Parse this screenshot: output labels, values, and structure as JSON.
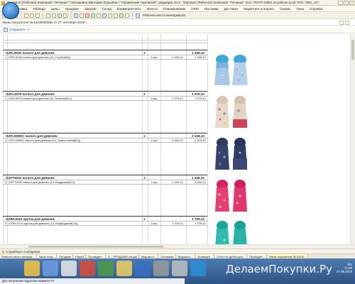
{
  "window": {
    "title": "Торговля (Рабочая) Компания \"Пеликан\" / Малашина Виктория Юрьевна / \"Управление торговлей\", редакция 10.3 - Торговля (Рабочая) Компания \"Пеликан\" Srvr=\"RSTD-DB01.int.pelican.local\";Ref=\"sl82_rst\";"
  },
  "menu": [
    "Файл",
    "Правка",
    "Таблица",
    "Цены",
    "Продажи",
    "Закупки",
    "Склад",
    "Взаиморасчеты",
    "Зачеты",
    "Планирование",
    "CRM",
    "Поставки",
    "Доставка",
    "Маркетинг и анализ",
    "Сервис",
    "Окна",
    "Справка"
  ],
  "toolbar": {
    "label": "Рабочее место менеджеров"
  },
  "document": {
    "title": "Заказ покупателя № 61/00009355 от 27 сентября 2019 г.",
    "save_label": "Сохранить"
  },
  "products": [
    {
      "title": "GZFL5030 пальто для девочек",
      "qty": "1",
      "sum": "1 439,10",
      "row": {
        "num": "1",
        "desc": "GZFL5030 пальто для девочек (14, Голубой(9))",
        "qty": "1 кор",
        "price": "1 439,10",
        "sum": "1 439,10"
      }
    },
    {
      "title": "GZFL5079 пальто для девочек",
      "qty": "1",
      "sum": "1 979,10",
      "row": {
        "num": "2",
        "desc": "GZFL5079 пальто для девочек (14, Бежевый(1))",
        "qty": "1 кор",
        "price": "1 979,10",
        "sum": "1 979,10"
      }
    },
    {
      "title": "GZFL5080/1 пальто для девочек",
      "qty": "1",
      "sum": "2 249,10",
      "row": {
        "num": "3",
        "desc": "GZFL5080/1 пальто для девочек (14, Темно-синий(54))",
        "qty": "1 кор",
        "price": "2 249,10",
        "sum": "2 249,10"
      }
    },
    {
      "title": "GZFT5032 пальто для девочек",
      "qty": "1",
      "sum": "1 439,10",
      "row": {
        "num": "4",
        "desc": "GZFT5032 пальто для девочек (14, Бордовый(47))",
        "qty": "1 кор",
        "price": "1 439,10",
        "sum": "1 439,10"
      }
    },
    {
      "title": "GZWL5110 куртка для девочек",
      "qty": "1",
      "sum": "1 709,10",
      "row": {
        "num": "5",
        "desc": "GZWL5110 куртка для девочек (14, Изумрудный(14))",
        "qty": "1 кор",
        "price": "1 709,10",
        "sum": "1 709,10"
      }
    }
  ],
  "messages": {
    "label": "Служебные сообщения"
  },
  "window_tabs": [
    "Рабочее место менедж...",
    "Заказ поку...",
    "Продажи",
    "Новый",
    "Проведен...",
    "П... ПРОДАЖИ общие",
    "Ведомост...",
    "Основная",
    "Ведомост...",
    "Проведен...",
    "Отчет по дебиторск...",
    "Проведен...",
    "Заказ покупателя № 61/00..."
  ],
  "status_line": "Для получения подсказки нажмите F1",
  "watermark": "ДелаемПокупки.Ру",
  "tray": {
    "lang": "RU",
    "time": "11:09",
    "date": "27.09.2019"
  },
  "colors": {
    "accent": "#1a4f9c",
    "taskbar": "#2d5585"
  }
}
